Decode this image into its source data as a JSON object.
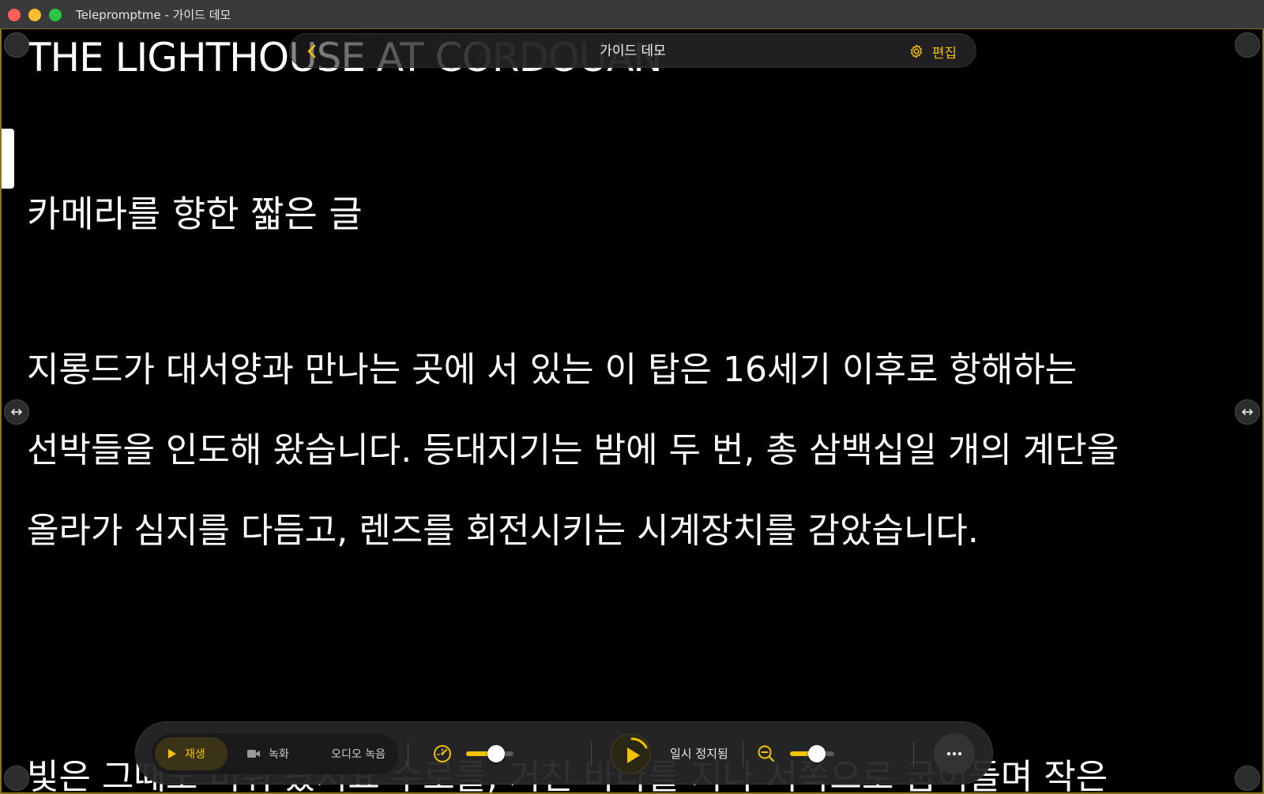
{
  "window": {
    "title": "Teleprompt​me - 가이드 데모"
  },
  "topbar": {
    "title": "가이드 데모",
    "back_icon": "chevron-left-icon",
    "edit_label": "편집",
    "edit_icon": "gear-icon",
    "accent_color": "#f2c200"
  },
  "script": {
    "heading": "THE LIGHTHOUSE AT CORDOUAN",
    "subtitle": "카메라를 향한 짧은 글",
    "lines": [
      "지롱드가 대서양과 만나는 곳에 서 있는 이 탑은 16세기 이후로 항해하는",
      "선박들을 인도해 왔습니다. 등대지기는 밤에 두 번, 총 삼백십일 개의 계단을",
      "올라가 심지를 다듬고, 렌즈를 회전시키는 시계장치를 감았습니다.",
      "빛은 그때도 비춰 왔지요 수로를, 거친 바다를 지나 서쪽으로 굽이돌며 작은"
    ]
  },
  "controls": {
    "modes": [
      {
        "label": "재생",
        "icon": "play-icon",
        "selected": true
      },
      {
        "label": "녹화",
        "icon": "video-camera-icon",
        "selected": false
      },
      {
        "label": "오디오 녹음",
        "icon": "waveform-icon",
        "selected": false
      }
    ],
    "speed_icon": "speedometer-icon",
    "speed_level": 0.7,
    "play_icon": "play-icon",
    "status": "일시 정지됨",
    "zoom_icon": "zoom-out-icon",
    "zoom_level": 0.68,
    "more_icon": "ellipsis-icon"
  }
}
